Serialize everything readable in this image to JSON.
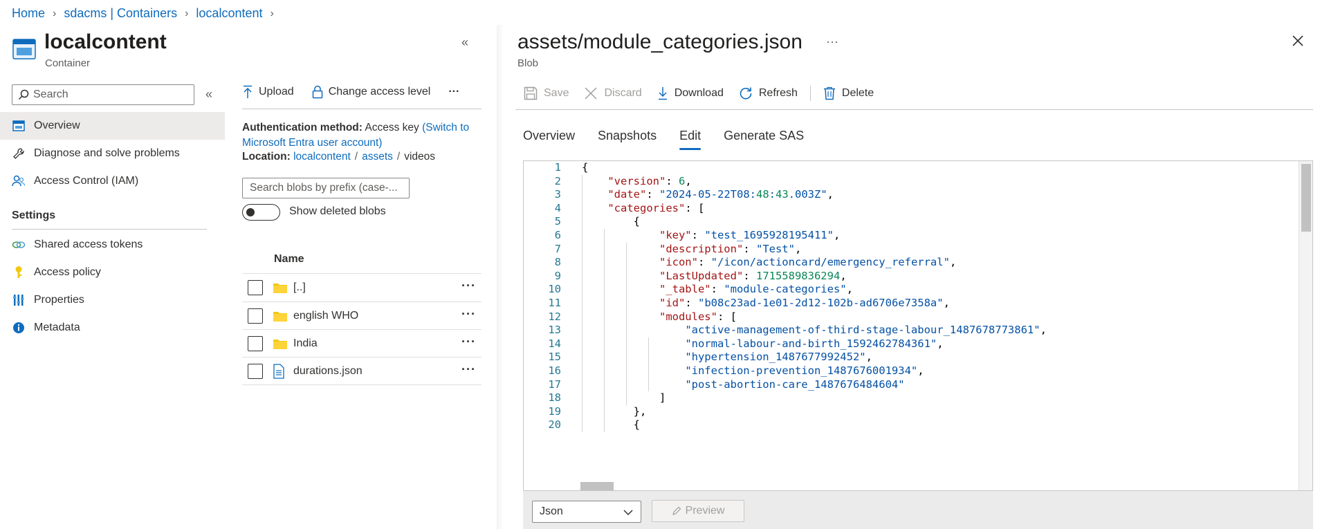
{
  "breadcrumb": [
    "Home",
    "sdacms | Containers",
    "localcontent"
  ],
  "resource": {
    "title": "localcontent",
    "subtitle": "Container",
    "collapse_label": "«"
  },
  "sidebar": {
    "search_placeholder": "Search",
    "collapse_label": "«",
    "items": [
      {
        "label": "Overview",
        "icon": "overview-icon",
        "active": true
      },
      {
        "label": "Diagnose and solve problems",
        "icon": "wrench-icon"
      },
      {
        "label": "Access Control (IAM)",
        "icon": "people-icon"
      }
    ],
    "settings_header": "Settings",
    "settings_items": [
      {
        "label": "Shared access tokens",
        "icon": "link-icon"
      },
      {
        "label": "Access policy",
        "icon": "key-icon"
      },
      {
        "label": "Properties",
        "icon": "properties-icon"
      },
      {
        "label": "Metadata",
        "icon": "info-icon"
      }
    ]
  },
  "middle": {
    "toolbar": {
      "upload": "Upload",
      "change_access": "Change access level",
      "more": "···"
    },
    "auth_label": "Authentication method:",
    "auth_value": "Access key",
    "auth_link": "(Switch to Microsoft Entra user account)",
    "location_label": "Location:",
    "location_path": [
      "localcontent",
      "assets",
      "videos"
    ],
    "blob_search_placeholder": "Search blobs by prefix (case-...",
    "show_deleted_label": "Show deleted blobs",
    "column_name": "Name",
    "rows": [
      {
        "name": "[..]",
        "type": "folder"
      },
      {
        "name": "english WHO",
        "type": "folder"
      },
      {
        "name": "India",
        "type": "folder"
      },
      {
        "name": "durations.json",
        "type": "file"
      }
    ],
    "row_more": "···"
  },
  "blob": {
    "title": "assets/module_categories.json",
    "more": "···",
    "subtitle": "Blob",
    "toolbar": {
      "save": "Save",
      "discard": "Discard",
      "download": "Download",
      "refresh": "Refresh",
      "delete": "Delete"
    },
    "tabs": [
      "Overview",
      "Snapshots",
      "Edit",
      "Generate SAS"
    ],
    "active_tab": "Edit",
    "line_numbers": [
      "1",
      "2",
      "3",
      "4",
      "5",
      "6",
      "7",
      "8",
      "9",
      "10",
      "11",
      "12",
      "13",
      "14",
      "15",
      "16",
      "17",
      "18",
      "19",
      "20"
    ],
    "code_lines": [
      "{",
      "    \"version\": 6,",
      "    \"date\": \"2024-05-22T08:48:43.003Z\",",
      "    \"categories\": [",
      "        {",
      "            \"key\": \"test_1695928195411\",",
      "            \"description\": \"Test\",",
      "            \"icon\": \"/icon/actioncard/emergency_referral\",",
      "            \"LastUpdated\": 1715589836294,",
      "            \"_table\": \"module-categories\",",
      "            \"id\": \"b08c23ad-1e01-2d12-102b-ad6706e7358a\",",
      "            \"modules\": [",
      "                \"active-management-of-third-stage-labour_1487678773861\",",
      "                \"normal-labour-and-birth_1592462784361\",",
      "                \"hypertension_1487677992452\",",
      "                \"infection-prevention_1487676001934\",",
      "                \"post-abortion-care_1487676484604\"",
      "            ]",
      "        },",
      "        {"
    ],
    "language": "Json",
    "preview_label": "Preview"
  },
  "colors": {
    "accent": "#0f6cbd",
    "json_key": "#a31515",
    "json_string": "#0451a5",
    "json_number": "#098658",
    "line_number": "#237893"
  }
}
